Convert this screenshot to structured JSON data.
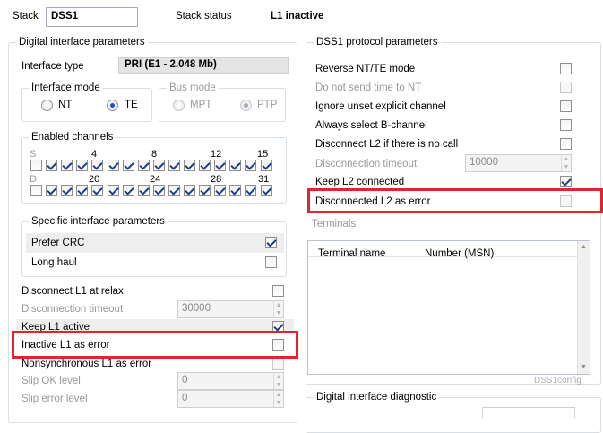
{
  "topbar": {
    "stack_label": "Stack",
    "stack_value": "DSS1",
    "status_label": "Stack status",
    "status_value": "L1 inactive"
  },
  "digital_interface": {
    "group_label": "Digital interface parameters",
    "interface_type_label": "Interface type",
    "interface_type_value": "PRI (E1 - 2.048 Mb)",
    "interface_mode": {
      "label": "Interface mode",
      "options": [
        "NT",
        "TE"
      ],
      "selected": "TE"
    },
    "bus_mode": {
      "label": "Bus mode",
      "options": [
        "MPT",
        "PTP"
      ],
      "selected": "PTP"
    },
    "enabled_channels": {
      "label": "Enabled channels",
      "row1_prefix": "S",
      "row2_prefix": "D",
      "row1_numbers": [
        "4",
        "8",
        "12",
        "15"
      ],
      "row2_numbers": [
        "20",
        "24",
        "28",
        "31"
      ]
    },
    "specific": {
      "label": "Specific interface parameters",
      "prefer_crc": "Prefer CRC",
      "long_haul": "Long haul"
    },
    "disconnect_l1_at_relax": "Disconnect L1 at relax",
    "disconnection_timeout_label": "Disconnection timeout",
    "disconnection_timeout_value": "30000",
    "keep_l1_active": "Keep L1 active",
    "inactive_l1_as_error": "Inactive L1 as error",
    "nonsynchronous_l1_as_error": "Nonsynchronous L1 as error",
    "slip_ok_label": "Slip OK level",
    "slip_ok_value": "0",
    "slip_error_label": "Slip error level",
    "slip_error_value": "0"
  },
  "dss1": {
    "group_label": "DSS1 protocol parameters",
    "reverse_nt_te": "Reverse NT/TE mode",
    "do_not_send_time": "Do not send time to NT",
    "ignore_unset_channel": "Ignore unset explicit channel",
    "always_select_b": "Always select B-channel",
    "disconnect_l2_no_call": "Disconnect L2 if there is no call",
    "l2_disconnection_timeout_label": "Disconnection timeout",
    "l2_disconnection_timeout_value": "10000",
    "keep_l2_connected": "Keep L2 connected",
    "disconnected_l2_as_error": "Disconnected L2 as error",
    "terminals_label": "Terminals",
    "terminals_columns": [
      "Terminal name",
      "Number (MSN)"
    ],
    "watermark": "DSS1config"
  },
  "diagnostic": {
    "group_label": "Digital interface diagnostic"
  },
  "colors": {
    "highlight": "#e0252e",
    "check": "#1d3f8a"
  }
}
